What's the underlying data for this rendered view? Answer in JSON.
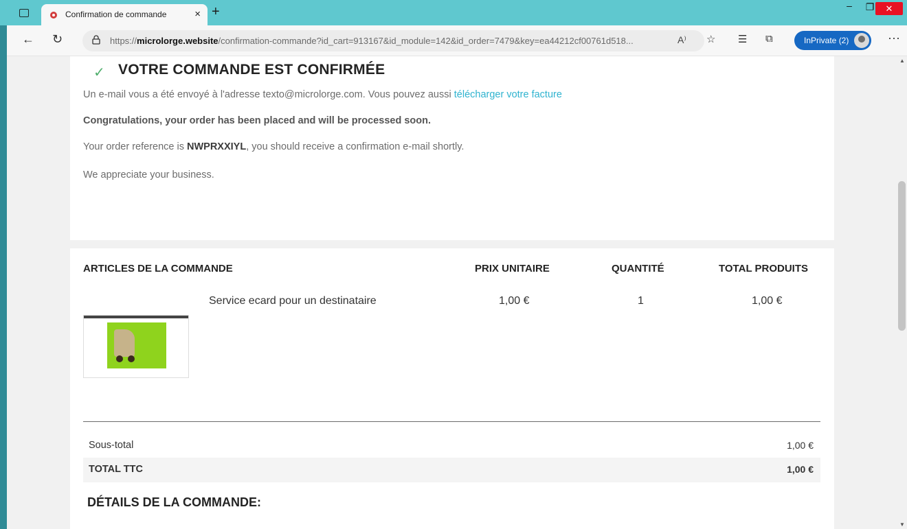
{
  "browser": {
    "tab_title": "Confirmation de commande",
    "tab_close": "×",
    "new_tab": "+",
    "url_prefix": "https://",
    "url_domain": "microlorge.website",
    "url_path": "/confirmation-commande?id_cart=913167&id_module=142&id_order=7479&key=ea44212cf00761d518...",
    "read_aloud": "A⁾",
    "profile_label": "InPrivate (2)",
    "more_label": "···",
    "minimize": "–",
    "maximize": "❐",
    "close": "✕"
  },
  "confirmation": {
    "title": "VOTRE COMMANDE EST CONFIRMÉE",
    "email_text": "Un e-mail vous a été envoyé à l'adresse texto@microlorge.com. Vous pouvez aussi ",
    "invoice_link": "télécharger votre facture",
    "congrats": "Congratulations, your order has been placed and will be processed soon.",
    "ref_prefix": "Your order reference is ",
    "ref_code": "NWPRXXIYL",
    "ref_suffix": ", you should receive a confirmation e-mail shortly.",
    "thanks": "We appreciate your business."
  },
  "order": {
    "headers": {
      "items": "ARTICLES DE LA COMMANDE",
      "unit_price": "PRIX UNITAIRE",
      "quantity": "QUANTITÉ",
      "total": "TOTAL PRODUITS"
    },
    "item": {
      "name": "Service ecard pour un destinataire",
      "unit_price": "1,00 €",
      "quantity": "1",
      "total": "1,00 €"
    },
    "subtotal_label": "Sous-total",
    "subtotal_value": "1,00 €",
    "total_label": "TOTAL TTC",
    "total_value": "1,00 €",
    "details_title": "DÉTAILS DE LA COMMANDE:"
  },
  "colors": {
    "titlebar": "#5fc8cf",
    "link": "#2fb3cf",
    "check": "#4fae6c",
    "inprivate": "#1668c3"
  }
}
